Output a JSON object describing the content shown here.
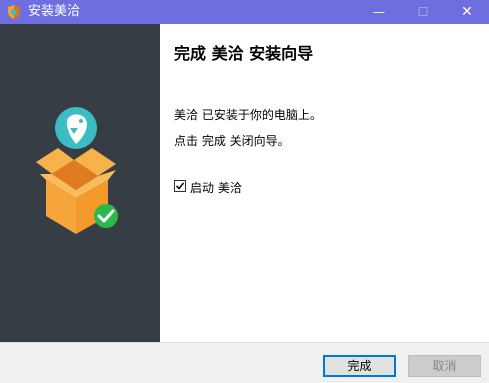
{
  "window": {
    "title": "安装美洽",
    "minimize_glyph": "—",
    "maximize_glyph": "☐",
    "close_glyph": "✕"
  },
  "icons": {
    "app": "installer-shield-icon",
    "illustration": "package-box-icon",
    "parrot": "meiqia-parrot-icon",
    "success": "check-circle-icon"
  },
  "content": {
    "heading": "完成 美洽 安装向导",
    "message_line1": "美洽 已安装于你的电脑上。",
    "message_line2": "点击 完成 关闭向导。",
    "launch_checkbox_label": "启动 美洽",
    "launch_checked": true
  },
  "buttons": {
    "finish": "完成",
    "cancel": "取消"
  },
  "colors": {
    "titlebar": "#6e6ee0",
    "sidebar": "#363d45",
    "box_orange": "#f5a53a",
    "parrot_teal": "#3cbcc4",
    "success_green": "#2db84d",
    "focus_border": "#0078d7"
  }
}
